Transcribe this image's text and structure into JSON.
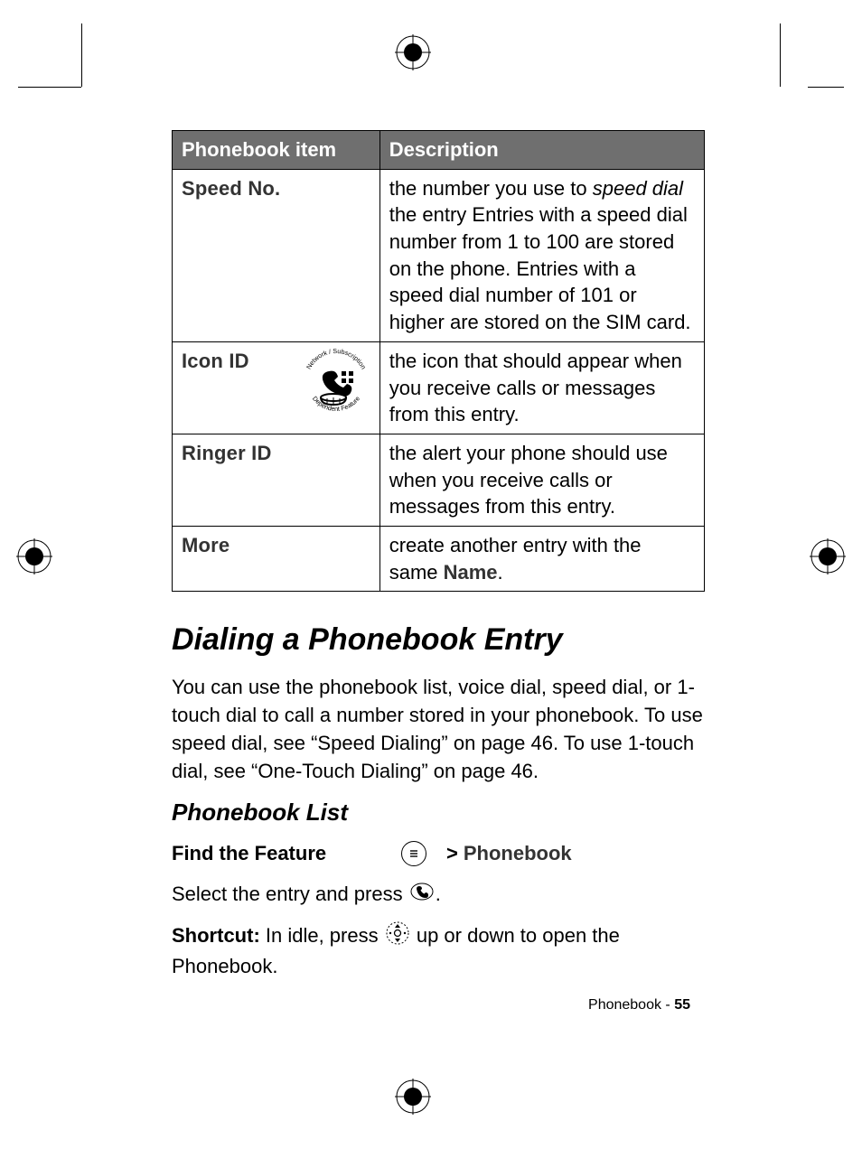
{
  "table": {
    "headers": [
      "Phonebook item",
      "Description"
    ],
    "rows": [
      {
        "item": "Speed No.",
        "desc_parts": {
          "pre": "the number you use to ",
          "italic": "speed dial",
          "post": " the entry Entries with a speed dial number from 1 to 100 are stored on the phone. Entries with a speed dial number of 101 or higher are stored on the SIM card."
        },
        "has_net_icon": false
      },
      {
        "item": "Icon ID",
        "desc": "the icon that should appear when you receive calls or messages from this entry.",
        "has_net_icon": true
      },
      {
        "item": "Ringer ID",
        "desc": "the alert your phone should use when you receive calls or messages from this entry.",
        "has_net_icon": false
      },
      {
        "item": "More",
        "desc_parts2": {
          "pre": "create another entry with the same ",
          "bold": "Name",
          "post": "."
        },
        "has_net_icon": false
      }
    ]
  },
  "section_title": "Dialing a Phonebook Entry",
  "section_body": "You can use the phonebook list, voice dial, speed dial, or 1-touch dial to call a number stored in your phonebook. To use speed dial, see “Speed Dialing” on page 46. To use 1-touch dial, see “One-Touch Dialing” on page 46.",
  "subsection_title": "Phonebook List",
  "find_feature": {
    "label": "Find the Feature",
    "gt": ">",
    "menu": "Phonebook"
  },
  "line1": {
    "pre": "Select the entry and press ",
    "post": "."
  },
  "line2": {
    "boldpre": "Shortcut:",
    "pre": " In idle, press ",
    "post": " up or down to open the Phonebook."
  },
  "footer": {
    "section": "Phonebook - ",
    "page": "55"
  },
  "net_badge": {
    "top": "Network / Subscription",
    "bottom": "Dependent Feature"
  }
}
